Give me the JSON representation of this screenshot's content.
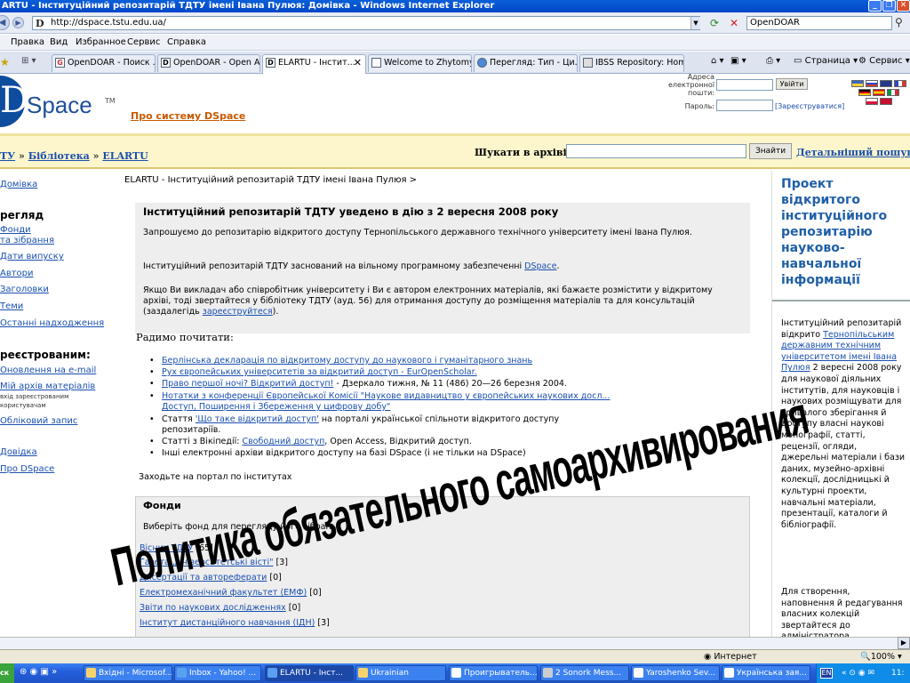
{
  "window": {
    "title": "ARTU - Інституційний репозитарій ТДТУ імені Івана Пулюя: Домівка - Windows Internet Explorer"
  },
  "addressbar": {
    "url": "http://dspace.tstu.edu.ua/",
    "search_value": "OpenDOAR"
  },
  "menu": {
    "items": [
      "Правка",
      "Вид",
      "Избранное",
      "Сервис",
      "Справка"
    ]
  },
  "tabs": [
    {
      "label": "OpenDOAR - Поиск ..."
    },
    {
      "label": "OpenDOAR - Open A..."
    },
    {
      "label": "ELARTU - Інстит..."
    },
    {
      "label": "Welcome to Zhytomy..."
    },
    {
      "label": "Перегляд: Тип - Ци..."
    },
    {
      "label": "IBSS Repository: Home"
    }
  ],
  "ie_tools": {
    "page": "Страница",
    "service": "Сервис"
  },
  "header": {
    "logo_text": "Space",
    "logo_tm": "TM",
    "about_link": "Про систему DSpace",
    "email_label": "Адреса електронної пошти:",
    "password_label": "Пароль:",
    "login_button": "Увійти",
    "register_link": "[Зареєструватися]"
  },
  "searchstrip": {
    "breadcrumb": [
      "ТУ",
      "Бібліотека",
      "ELARTU"
    ],
    "search_label": "Шукати в архіві",
    "search_button": "Знайти",
    "advanced_link": "Детальніший пошук"
  },
  "leftnav": {
    "home": "Домівка",
    "browse_head": "регляд",
    "browse_items": [
      "Фонди",
      "та зібрання",
      "Дати випуску",
      "Автори",
      "Заголовки",
      "Теми",
      "Останні надходження"
    ],
    "registered_head": "реєстрованим:",
    "reg_items": [
      "Оновлення на e-mail",
      "Мій архів матеріалів"
    ],
    "reg_note": [
      "вхід зареєстрованим",
      "користувачам"
    ],
    "account": "Обліковий запис",
    "help": "Довідка",
    "about": "Про DSpace"
  },
  "main": {
    "crumb": "ELARTU - Інституційний репозитарій ТДТУ імені Івана Пулюя >",
    "news_title": "Інституційний репозитарій ТДТУ уведено в дію з 2 вересня 2008 року",
    "p1": "Запрошуємо до репозитарію відкритого доступу Тернопільського державного технічного університету імені Івана Пулюя.",
    "p2_pre": "Інституційний репозитарій ТДТУ заснований на вільному програмному забезпеченні ",
    "p2_link": "DSpace",
    "p2_post": ".",
    "p3_pre": "Якщо Ви викладач або співробітник університету і Ви є автором електронних матеріалів, які бажаєте розмістити у відкритому архіві, тоді звертайтеся у бібліотеку ТДТУ (ауд. 56) для отримання доступу до розміщення матеріалів та для консультацій (заздалегідь ",
    "p3_link": "зареєструйтеся",
    "p3_post": ").",
    "radimo": "Радимо почитати:",
    "links": [
      {
        "link": "Берлінська декларація по відкритому доступу до наукового і гуманітарного знань",
        "post": ""
      },
      {
        "link": "Рух європейських університетів за відкритий доступ - EurOpenScholar.",
        "post": ""
      },
      {
        "link": "Право першої ночі? Відкритий доступ!",
        "post": " - Дзеркало тижня, № 11 (486) 20—26 березня 2004."
      },
      {
        "link": "Нотатки з конференції Європейської Комісії \"Наукове видавництво у європейських наукових досл...",
        "post": ""
      },
      {
        "link": "Доступ, Поширення і Збереження у цифрову добу\"",
        "post": ""
      },
      {
        "pre": "Стаття ",
        "link": "'Що таке відкритий доступ'",
        "post": " на порталі української спільноти відкритого доступу"
      },
      {
        "pre": "репозитаріїв.",
        "link": "",
        "post": ""
      },
      {
        "pre": "Статті з Вікіпедії: ",
        "link": "Свободний доступ",
        "post": ", Open Access, Відкритий доступ."
      },
      {
        "pre": "Інші електронні архіви відкритого доступу на базі DSpace (і не тільки на DSpace)",
        "link": "",
        "post": ""
      }
    ],
    "ctop": "Заходьте на портал по інститутах",
    "fondy_title": "Фонди",
    "fondy_sub": "Виберіть фонд для перегляду його зібрань.",
    "communities": [
      {
        "name": "Вісник ТДТУ",
        "count": "[65]"
      },
      {
        "name": "Газета „Університетські вісті\"",
        "count": "[3]"
      },
      {
        "name": "Дисертації та автореферати",
        "count": "[0]"
      },
      {
        "name": "Електромеханічний факультет (ЕМФ)",
        "count": "[0]"
      },
      {
        "name": "Звіти по наукових дослідженнях",
        "count": "[0]"
      },
      {
        "name": "Інститут дистанційного навчання (ІДН)",
        "count": "[3]"
      }
    ]
  },
  "rightbar": {
    "title": "Проект відкритого інституційного репозитарію науково-навчальної інформації",
    "text1_pre": "Інституційний репозитарій відкрито ",
    "text1_link": "Тернопільським державним технічним університетом імені Івана Пулюя",
    "text1_post": " 2 вересні 2008 року для наукової діяльних інститутів, для науковців і наукових розміщувати для тривалого зберігання й доступу власні наукові монографії, статті, рецензії, огляди, джерельні матеріали і бази даних, музейно-архівні колекції, дослідницькі й культурні проекти, навчальні матеріали, презентації, каталоги й бібліографії.",
    "text2": "Для створення, наповнення й редагування власних колекцій звертайтеся до адміністратора"
  },
  "overlay": {
    "text": "Политика обязательного самоархивирования"
  },
  "statusbar": {
    "zone": "Интернет",
    "zoom": "100%"
  },
  "taskbar": {
    "start": "ск",
    "buttons": [
      "Вхідні - Microsof...",
      "Inbox - Yahoo! ...",
      "ELARTU - Інст...",
      "Ukrainian",
      "Проигрыватель...",
      "2 Sonork Mess...",
      "Yaroshenko Sev...",
      "Українська зая..."
    ],
    "lang": "EN",
    "clock": "11:"
  }
}
